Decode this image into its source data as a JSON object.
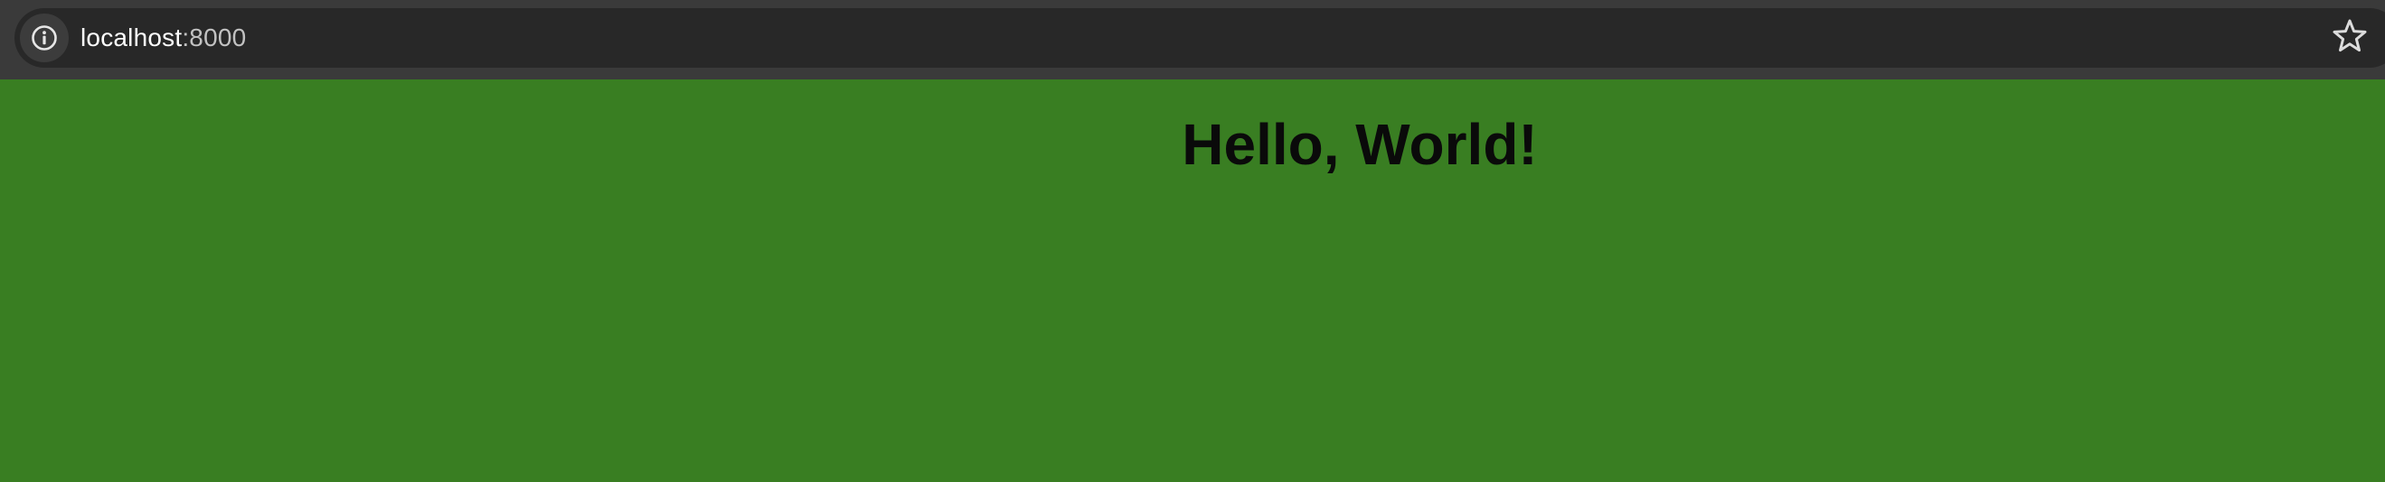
{
  "browser": {
    "url_host": "localhost",
    "url_port": ":8000",
    "info_icon": "info-icon",
    "bookmark_icon": "star-outline-icon"
  },
  "page": {
    "heading": "Hello, World!",
    "background_color": "#397e22"
  }
}
